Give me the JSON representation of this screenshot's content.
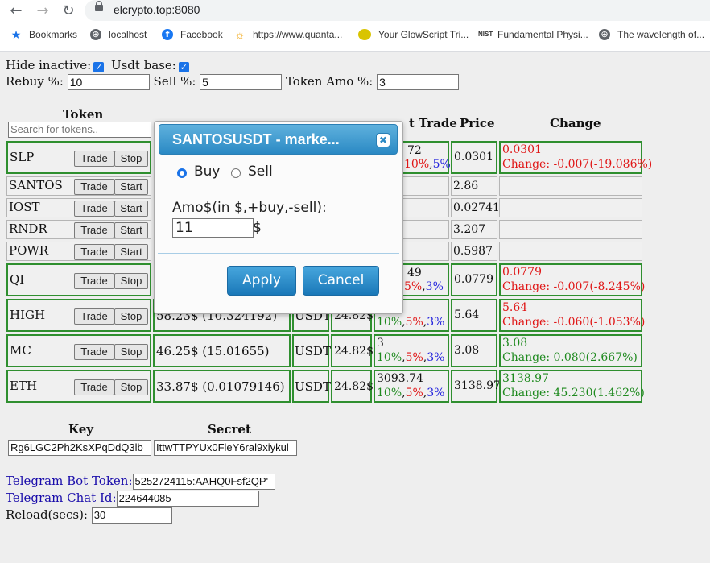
{
  "browser": {
    "url": "elcrypto.top:8080",
    "bookmarks": [
      {
        "label": "Bookmarks",
        "icon": "star-icon"
      },
      {
        "label": "localhost",
        "icon": "globe-icon"
      },
      {
        "label": "Facebook",
        "icon": "facebook-icon"
      },
      {
        "label": "https://www.quanta...",
        "icon": "sun-icon"
      },
      {
        "label": "Your GlowScript Tri...",
        "icon": "glowscript-icon"
      },
      {
        "label": "Fundamental Physi...",
        "icon": "nist-icon",
        "icon_text": "NIST"
      },
      {
        "label": "The wavelength of...",
        "icon": "globe-icon"
      }
    ]
  },
  "settings": {
    "hide_inactive_label": "Hide inactive:",
    "usdt_base_label": "Usdt base:",
    "rebuy_label": "Rebuy %:",
    "rebuy_value": "10",
    "sell_label": "Sell %:",
    "sell_value": "5",
    "token_amo_label": "Token Amo %:",
    "token_amo_value": "3"
  },
  "table": {
    "headers": {
      "token": "Token",
      "last_trade_partial": "t Trade",
      "price": "Price",
      "change": "Change"
    },
    "search_placeholder": "Search for tokens..",
    "rows": [
      {
        "token": "SLP",
        "action": "Trade",
        "toggle": "Stop",
        "active": true,
        "trade_value_partial": "72",
        "pct_a": "10%",
        "pct_b": "5%",
        "price": "0.0301",
        "change_price": "0.0301",
        "change_text": "Change: -0.007(-19.086%)",
        "dir": "down"
      },
      {
        "token": "SANTOS",
        "action": "Trade",
        "toggle": "Start",
        "active": false,
        "price": "2.86"
      },
      {
        "token": "IOST",
        "action": "Trade",
        "toggle": "Start",
        "active": false,
        "price": "0.02741"
      },
      {
        "token": "RNDR",
        "action": "Trade",
        "toggle": "Start",
        "active": false,
        "price": "3.207"
      },
      {
        "token": "POWR",
        "action": "Trade",
        "toggle": "Start",
        "active": false,
        "price": "0.5987"
      },
      {
        "token": "QI",
        "action": "Trade",
        "toggle": "Stop",
        "active": true,
        "trade_value_partial": "49",
        "pct_a": "5%",
        "pct_b": "3%",
        "price": "0.0779",
        "change_price": "0.0779",
        "change_text": "Change: -0.007(-8.245%)",
        "dir": "down"
      },
      {
        "token": "HIGH",
        "action": "Trade",
        "toggle": "Stop",
        "active": true,
        "balance": "58.23$ (10.324192)",
        "base": "USDT",
        "budget": "24.82$",
        "pct_a": "10%",
        "pct_b": "5%",
        "pct_c": "3%",
        "price": "5.64",
        "change_price": "5.64",
        "change_text": "Change: -0.060(-1.053%)",
        "dir": "down"
      },
      {
        "token": "MC",
        "action": "Trade",
        "toggle": "Stop",
        "active": true,
        "balance": "46.25$ (15.01655)",
        "base": "USDT",
        "budget": "24.82$",
        "trade_value": "3",
        "pct_a": "10%",
        "pct_b": "5%",
        "pct_c": "3%",
        "price": "3.08",
        "change_price": "3.08",
        "change_text": "Change: 0.080(2.667%)",
        "dir": "up"
      },
      {
        "token": "ETH",
        "action": "Trade",
        "toggle": "Stop",
        "active": true,
        "balance": "33.87$ (0.01079146)",
        "base": "USDT",
        "budget": "24.82$",
        "trade_value": "3093.74",
        "pct_a": "10%",
        "pct_b": "5%",
        "pct_c": "3%",
        "price": "3138.97",
        "change_price": "3138.97",
        "change_text": "Change: 45.230(1.462%)",
        "dir": "up"
      }
    ]
  },
  "keys": {
    "key_header": "Key",
    "secret_header": "Secret",
    "key_value": "Rg6LGC2Ph2KsXPqDdQ3lb",
    "secret_value": "IttwTTPYUx0FleY6ral9xiykul"
  },
  "telegram": {
    "bot_token_label": "Telegram Bot Token:",
    "bot_token_value": "5252724115:AAHQ0Fsf2QP'",
    "chat_id_label": "Telegram Chat Id:",
    "chat_id_value": "224644085",
    "reload_label": "Reload(secs):",
    "reload_value": "30"
  },
  "modal": {
    "title": "SANTOSUSDT - marke...",
    "buy_label": "Buy",
    "sell_label": "Sell",
    "selected": "Buy",
    "amount_label": "Amo$(in $,+buy,-sell):",
    "amount_value": "11",
    "amount_suffix": "$",
    "apply_label": "Apply",
    "cancel_label": "Cancel"
  },
  "colors": {
    "active_border": "#2f8f2f",
    "down": "#e01616",
    "up": "#1f8a1f",
    "dialog_accent": "#2a89c4"
  }
}
